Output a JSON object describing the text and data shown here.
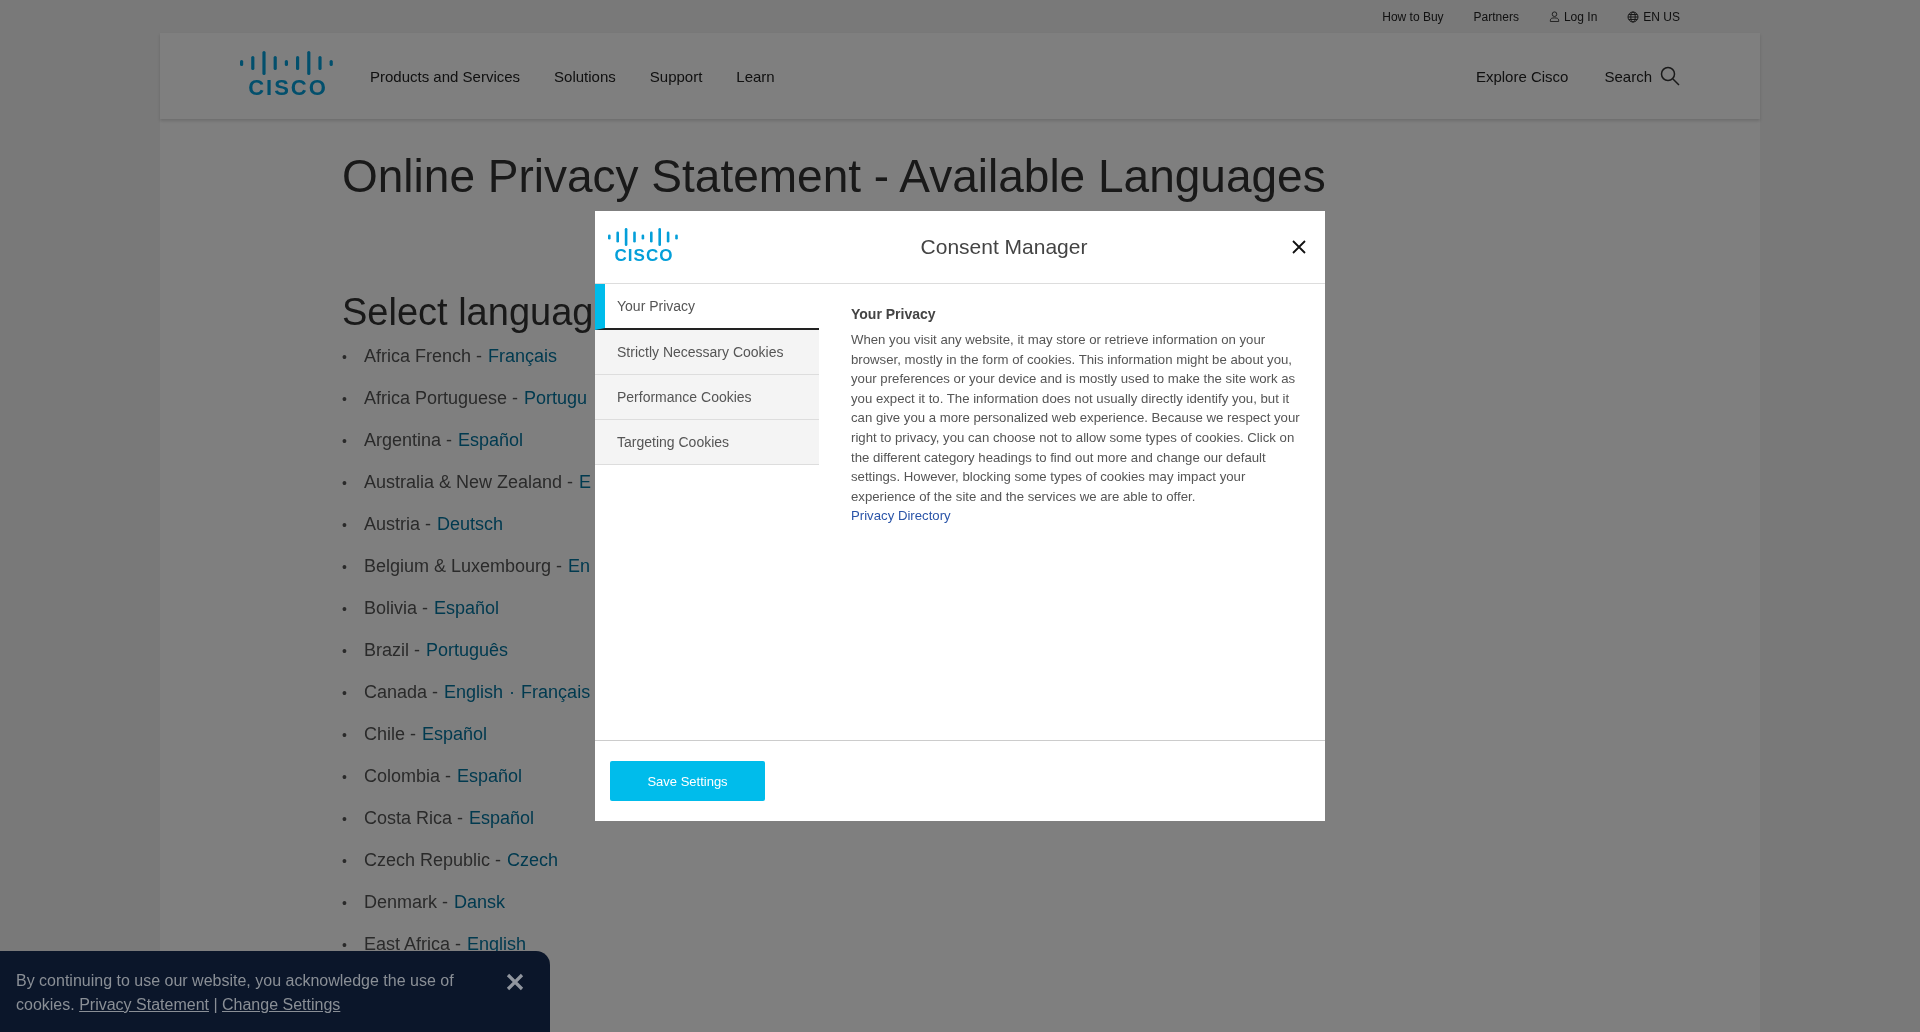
{
  "utility_bar": {
    "links": [
      {
        "label": "How to Buy",
        "kind": "plain"
      },
      {
        "label": "Partners",
        "kind": "plain"
      },
      {
        "label": "Log In",
        "kind": "account"
      },
      {
        "label": "EN US",
        "kind": "language"
      }
    ]
  },
  "header": {
    "logo": "CISCO",
    "nav": [
      "Products and Services",
      "Solutions",
      "Support",
      "Learn"
    ],
    "explore": "Explore Cisco",
    "search": "Search"
  },
  "page": {
    "title": "Online Privacy Statement - Available Languages",
    "heading": "Select languag",
    "link_separator": "·",
    "bullet": "•",
    "items": [
      {
        "country": "Africa French -",
        "links": [
          "Français"
        ]
      },
      {
        "country": "Africa Portuguese -",
        "links": [
          "Portugu"
        ]
      },
      {
        "country": "Argentina -",
        "links": [
          "Español"
        ]
      },
      {
        "country": "Australia & New Zealand -",
        "links": [
          "E"
        ]
      },
      {
        "country": "Austria -",
        "links": [
          "Deutsch"
        ]
      },
      {
        "country": "Belgium & Luxembourg -",
        "links": [
          "En"
        ]
      },
      {
        "country": "Bolivia -",
        "links": [
          "Español"
        ]
      },
      {
        "country": "Brazil -",
        "links": [
          "Português"
        ]
      },
      {
        "country": "Canada -",
        "links": [
          "English",
          "Français"
        ]
      },
      {
        "country": "Chile -",
        "links": [
          "Español"
        ]
      },
      {
        "country": "Colombia -",
        "links": [
          "Español"
        ]
      },
      {
        "country": "Costa Rica -",
        "links": [
          "Español"
        ]
      },
      {
        "country": "Czech Republic -",
        "links": [
          "Czech"
        ]
      },
      {
        "country": "Denmark -",
        "links": [
          "Dansk"
        ]
      },
      {
        "country": "East Africa -",
        "links": [
          "English"
        ]
      }
    ]
  },
  "consent_modal": {
    "logo": "CISCO",
    "title": "Consent Manager",
    "tabs": [
      {
        "label": "Your Privacy",
        "selected": true
      },
      {
        "label": "Strictly Necessary Cookies",
        "selected": false
      },
      {
        "label": "Performance Cookies",
        "selected": false
      },
      {
        "label": "Targeting Cookies",
        "selected": false
      }
    ],
    "content_title": "Your Privacy",
    "content_text": "When you visit any website, it may store or retrieve information on your browser, mostly in the form of cookies. This information might be about you, your preferences or your device and is mostly used to make the site work as you expect it to. The information does not usually directly identify you, but it can give you a more personalized web experience. Because we respect your right to privacy, you can choose not to allow some types of cookies. Click on the different category headings to find out more and change our default settings. However, blocking some types of cookies may impact your experience of the site and the services we are able to offer.",
    "content_link": "Privacy Directory",
    "save_button": "Save Settings"
  },
  "cookie_banner": {
    "text": "By continuing to use our website, you acknowledge the use of cookies.",
    "links": [
      "Privacy Statement",
      "Change Settings"
    ],
    "separator": "|"
  }
}
